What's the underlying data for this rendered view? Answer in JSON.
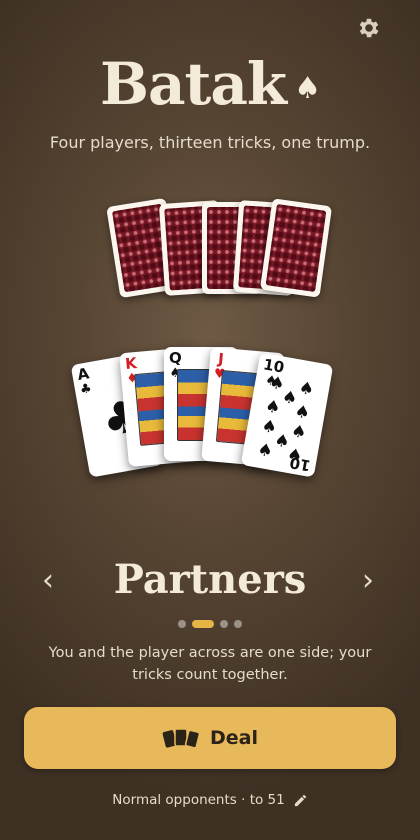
{
  "header": {
    "title": "Batak",
    "title_suit": "♠",
    "subtitle": "Four players, thirteen tricks, one trump.",
    "settings_icon": "gear-icon"
  },
  "hand": [
    {
      "rank": "A",
      "suit": "♣",
      "color": "black"
    },
    {
      "rank": "K",
      "suit": "♦",
      "color": "red"
    },
    {
      "rank": "Q",
      "suit": "♠",
      "color": "black"
    },
    {
      "rank": "J",
      "suit": "♥",
      "color": "red"
    },
    {
      "rank": "10",
      "suit": "♠",
      "color": "black"
    }
  ],
  "mode": {
    "label": "Partners",
    "description": "You and the player across are one side; your tricks count together.",
    "prev_icon": "chevron-left-icon",
    "next_icon": "chevron-right-icon",
    "page_count": 4,
    "active_index": 1
  },
  "deal_button": {
    "label": "Deal",
    "icon": "cards-icon"
  },
  "footer": {
    "text": "Normal opponents · to 51",
    "icon": "pencil-icon"
  },
  "colors": {
    "accent": "#e8b95a",
    "card_back": "#7a1724",
    "suit_red": "#d21f26"
  }
}
